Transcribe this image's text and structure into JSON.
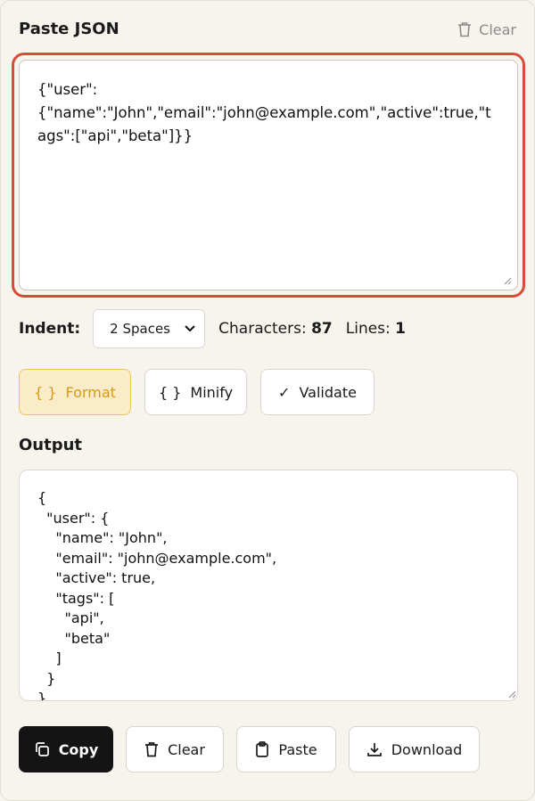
{
  "header": {
    "title": "Paste JSON",
    "clear_label": "Clear"
  },
  "input": {
    "value": "{\"user\":\n{\"name\":\"John\",\"email\":\"john@example.com\",\"active\":true,\"tags\":[\"api\",\"beta\"]}}"
  },
  "controls": {
    "indent_label": "Indent:",
    "indent_value": "2 Spaces",
    "characters_label": "Characters:",
    "characters_value": "87",
    "lines_label": "Lines:",
    "lines_value": "1"
  },
  "actions": {
    "format": "Format",
    "minify": "Minify",
    "validate": "Validate",
    "braces": "{ }",
    "check": "✓"
  },
  "output": {
    "title": "Output",
    "value": "{\n  \"user\": {\n    \"name\": \"John\",\n    \"email\": \"john@example.com\",\n    \"active\": true,\n    \"tags\": [\n      \"api\",\n      \"beta\"\n    ]\n  }\n}"
  },
  "bottom": {
    "copy": "Copy",
    "clear": "Clear",
    "paste": "Paste",
    "download": "Download"
  },
  "colors": {
    "accent_border": "#d94a38",
    "format_bg": "#fbecc9",
    "format_text": "#d99a13",
    "primary_dark": "#141414"
  }
}
